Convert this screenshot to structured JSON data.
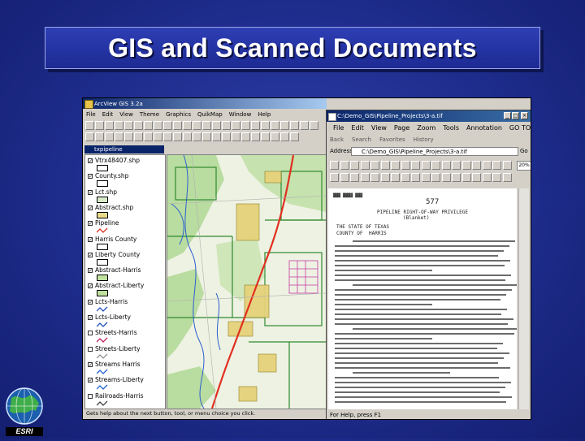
{
  "slide": {
    "title": "GIS and Scanned Documents",
    "logo_text": "ESRI",
    "background_color": "#1e2c8c"
  },
  "arcview": {
    "window_title": "ArcView GIS 3.2a",
    "menu": [
      "File",
      "Edit",
      "View",
      "Theme",
      "Graphics",
      "QuikMap",
      "Window",
      "Help"
    ],
    "view_title": "txpipeline",
    "status_text": "Gets help about the next button, tool, or menu choice you click.",
    "legend": [
      {
        "label": "Vtrx48407.shp",
        "checked": true,
        "symbol": "box",
        "color": "#ffffff"
      },
      {
        "label": "County.shp",
        "checked": true,
        "symbol": "box",
        "color": "#ffffff"
      },
      {
        "label": "Lct.shp",
        "checked": true,
        "symbol": "box",
        "color": "#d8eac8"
      },
      {
        "label": "Abstract.shp",
        "checked": true,
        "symbol": "box",
        "color": "#e9d98a"
      },
      {
        "label": "Pipeline",
        "checked": true,
        "symbol": "line",
        "color": "#e03020"
      },
      {
        "label": "Harris County",
        "checked": true,
        "symbol": "box",
        "color": "#ffffff"
      },
      {
        "label": "Liberty County",
        "checked": true,
        "symbol": "box",
        "color": "#ffffff"
      },
      {
        "label": "Abstract-Harris",
        "checked": true,
        "symbol": "box",
        "color": "#c0e0a0"
      },
      {
        "label": "Abstract-Liberty",
        "checked": true,
        "symbol": "box",
        "color": "#c0e0a0"
      },
      {
        "label": "Lcts-Harris",
        "checked": true,
        "symbol": "line",
        "color": "#2050c0"
      },
      {
        "label": "Lcts-Liberty",
        "checked": true,
        "symbol": "line",
        "color": "#2050c0"
      },
      {
        "label": "Streets-Harris",
        "checked": false,
        "symbol": "line",
        "color": "#c02060"
      },
      {
        "label": "Streets-Liberty",
        "checked": false,
        "symbol": "line",
        "color": "#909090"
      },
      {
        "label": "Streams Harris",
        "checked": true,
        "symbol": "line",
        "color": "#2060d0"
      },
      {
        "label": "Streams-Liberty",
        "checked": true,
        "symbol": "line",
        "color": "#2060d0"
      },
      {
        "label": "Railroads-Harris",
        "checked": false,
        "symbol": "line",
        "color": "#404040"
      }
    ]
  },
  "docviewer": {
    "window_title": "C:\\Demo_GIS\\Pipeline_Projects\\3-a.tif",
    "menu": [
      "File",
      "Edit",
      "View",
      "Page",
      "Zoom",
      "Tools",
      "Annotation",
      "GO TO"
    ],
    "nav": [
      "Back",
      "Search",
      "Favorites",
      "History"
    ],
    "address_label": "Address",
    "address_value": "C:\\Demo_GIS\\Pipeline_Projects\\3-a.tif",
    "go_label": "Go",
    "zoom_value": "20%",
    "status_text": "For Help, press F1",
    "doc_heading": "PIPELINE RIGHT-OF-WAY PRIVILEGE",
    "doc_subheading": "(Blanket)",
    "doc_state": "THE STATE OF TEXAS",
    "doc_county": "COUNTY OF",
    "doc_county_value": "HARRIS",
    "doc_number": "577"
  }
}
